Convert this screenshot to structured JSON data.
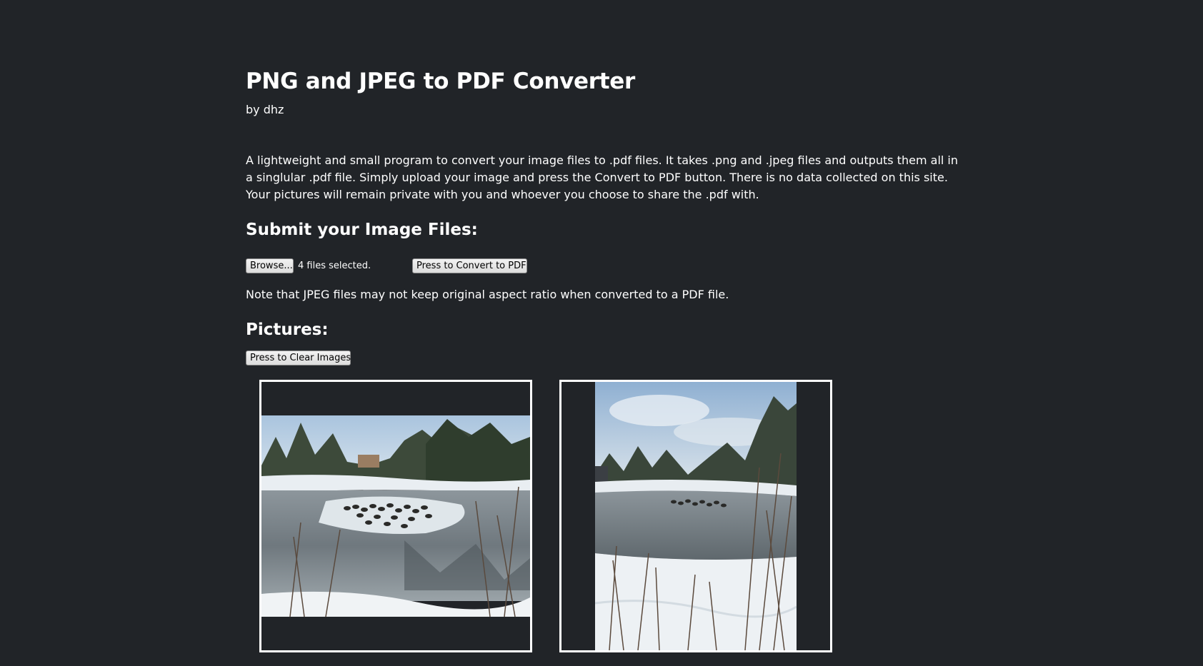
{
  "header": {
    "title": "PNG and JPEG to PDF Converter",
    "author": "by dhz"
  },
  "description": "A lightweight and small program to convert your image files to .pdf files. It takes .png and .jpeg files and outputs them all in a singlular .pdf file. Simply upload your image and press the Convert to PDF button. There is no data collected on this site. Your pictures will remain private with you and whoever you choose to share the .pdf with.",
  "submit_section": {
    "heading": "Submit your Image Files:",
    "browse_label": "Browse...",
    "file_status": "4 files selected.",
    "convert_label": "Press to Convert to PDF",
    "note": "Note that JPEG files may not keep original aspect ratio when converted to a PDF file."
  },
  "pictures_section": {
    "heading": "Pictures:",
    "clear_label": "Press to Clear Images",
    "pictures": [
      {
        "orientation": "landscape",
        "subject": "snowy pond with ducks"
      },
      {
        "orientation": "portrait",
        "subject": "snowy pond with trees"
      }
    ]
  },
  "colors": {
    "background": "#212428",
    "text": "#ffffff",
    "frame_border": "#ffffff"
  }
}
